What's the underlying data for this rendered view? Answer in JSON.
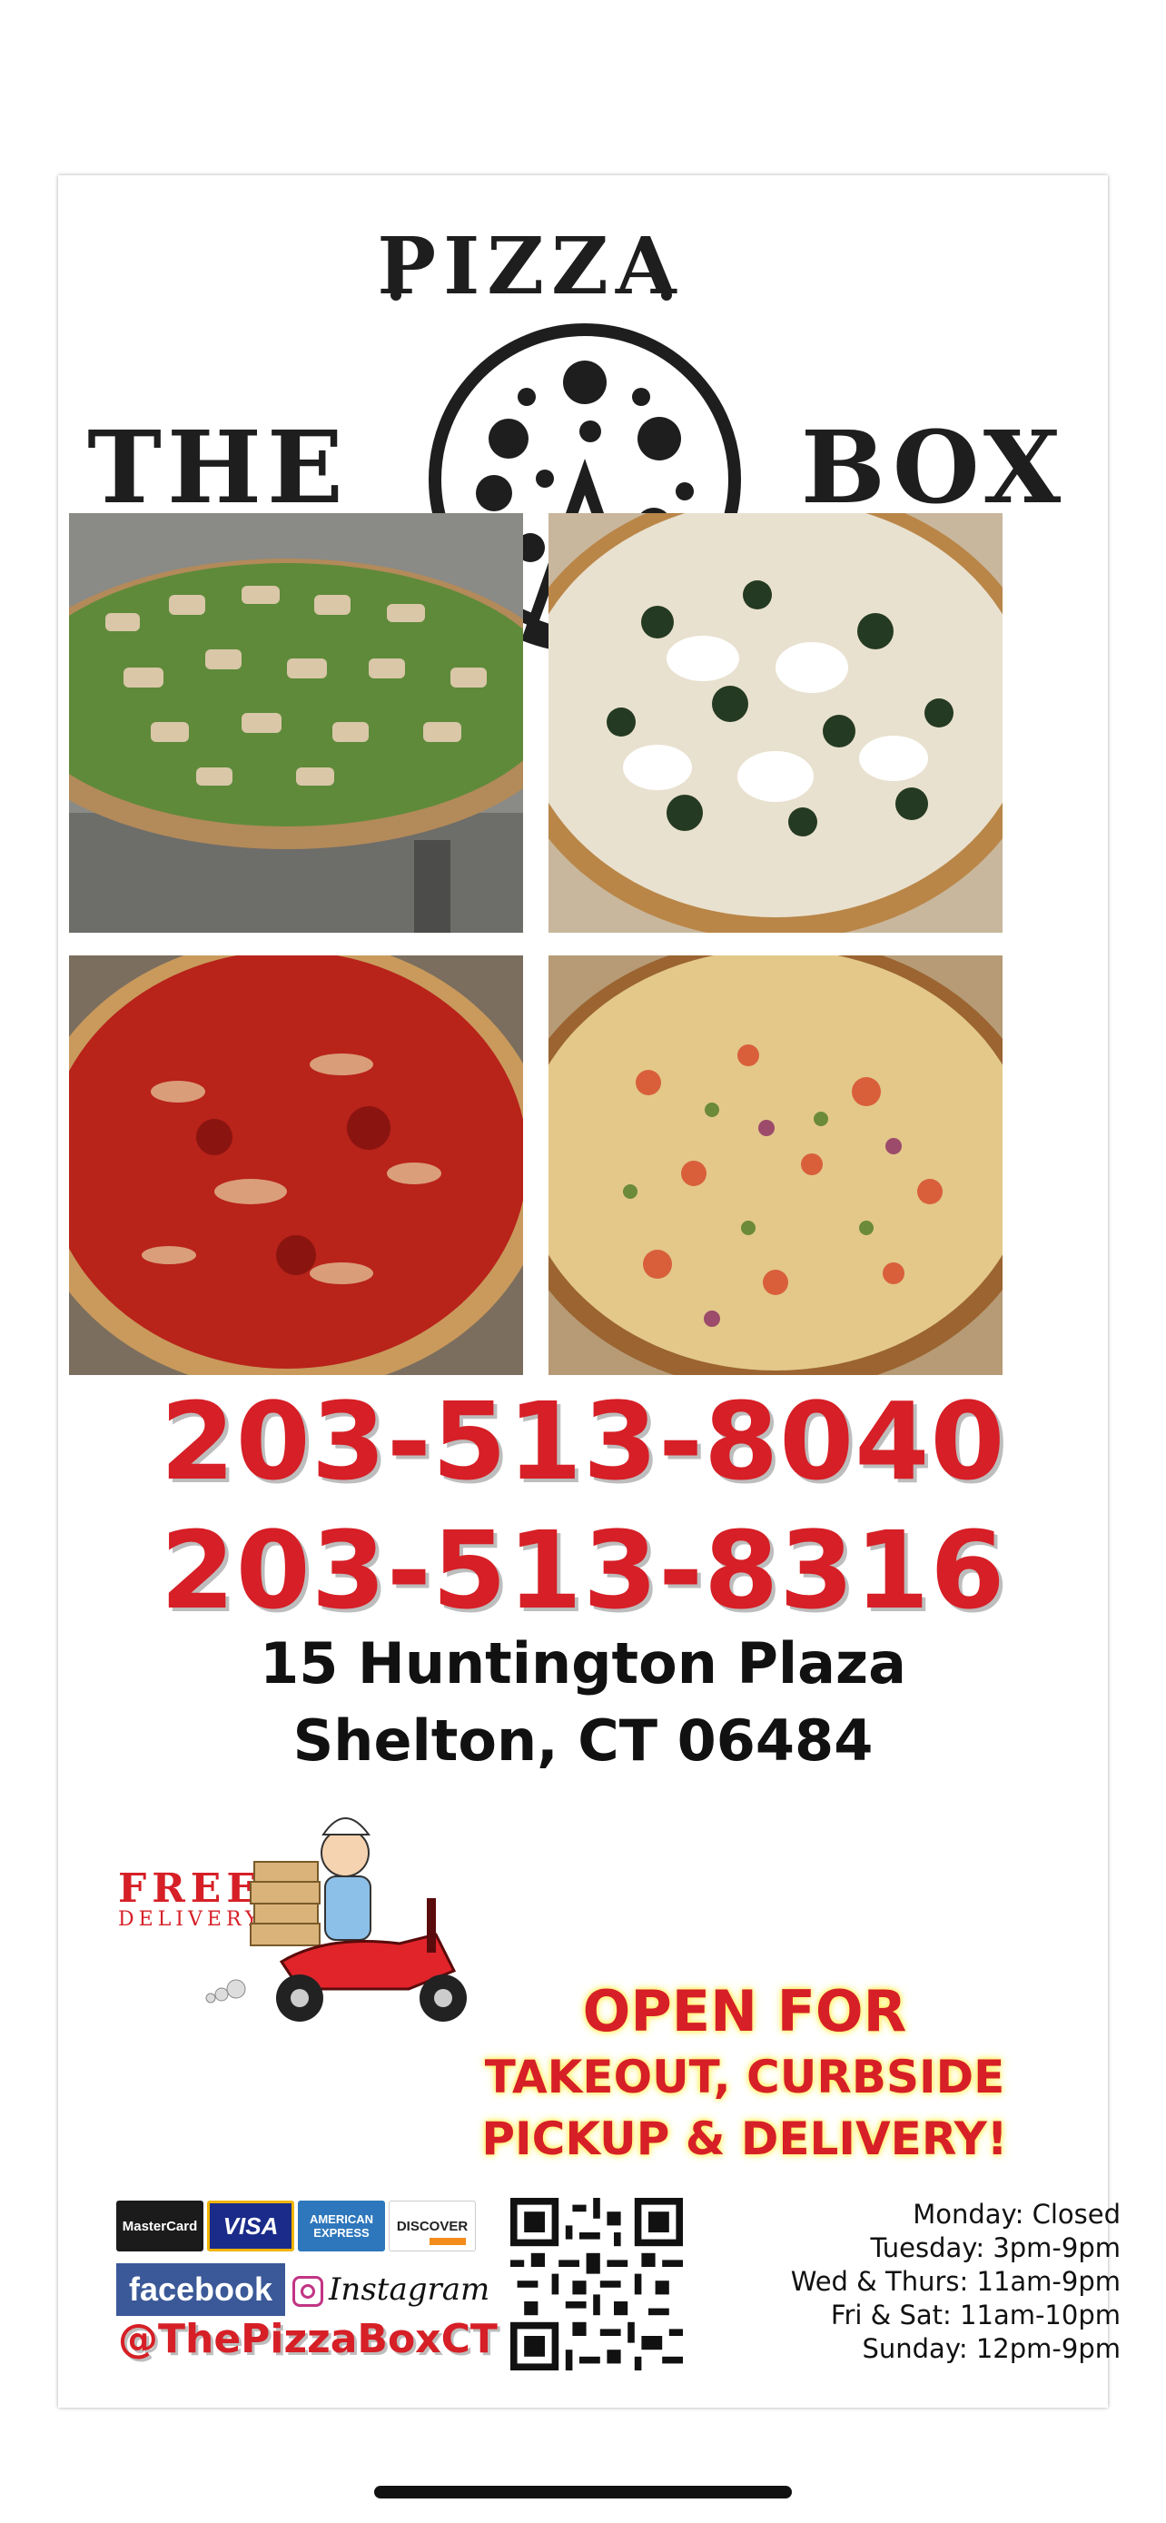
{
  "logo": {
    "top": "PIZZA",
    "left": "THE",
    "right": "BOX"
  },
  "photos": [
    {
      "name": "chicken-spinach-pizza"
    },
    {
      "name": "white-spinach-pizza"
    },
    {
      "name": "tomato-pie-pizza"
    },
    {
      "name": "vegetable-pizza"
    }
  ],
  "phones": [
    "203-513-8040",
    "203-513-8316"
  ],
  "address": {
    "line1": "15 Huntington Plaza",
    "line2": "Shelton, CT 06484"
  },
  "delivery": {
    "free": "FREE",
    "delivery": "DELIVERY!"
  },
  "open": {
    "line1": "OPEN FOR",
    "line2": "TAKEOUT, CURBSIDE",
    "line3": "PICKUP & DELIVERY!"
  },
  "payments": [
    "MasterCard",
    "VISA",
    "AMERICAN EXPRESS",
    "DISCOVER"
  ],
  "social": {
    "facebook": "facebook",
    "instagram": "Instagram",
    "handle": "@ThePizzaBoxCT"
  },
  "hours": [
    "Monday: Closed",
    "Tuesday: 3pm-9pm",
    "Wed & Thurs: 11am-9pm",
    "Fri & Sat: 11am-10pm",
    "Sunday: 12pm-9pm"
  ],
  "colors": {
    "accent": "#d61f26",
    "logo": "#1e1e1e"
  }
}
